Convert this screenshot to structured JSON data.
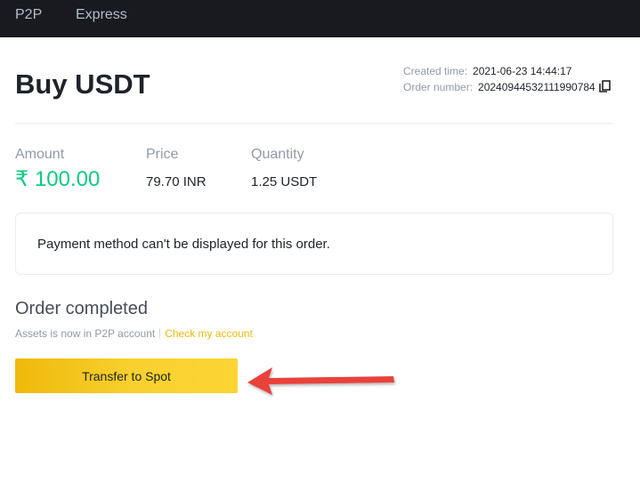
{
  "nav": {
    "items": [
      {
        "label": "P2P"
      },
      {
        "label": "Express"
      }
    ]
  },
  "order": {
    "title": "Buy USDT",
    "created_label": "Created time:",
    "created_value": "2021-06-23 14:44:17",
    "number_label": "Order number:",
    "number_value": "20240944532111990784"
  },
  "stats": {
    "amount_label": "Amount",
    "amount_value": "₹ 100.00",
    "price_label": "Price",
    "price_value": "79.70 INR",
    "quantity_label": "Quantity",
    "quantity_value": "1.25 USDT"
  },
  "payment": {
    "message": "Payment method can't be displayed for this order."
  },
  "status": {
    "title": "Order completed",
    "subtitle": "Assets is now in P2P account",
    "link": "Check my account"
  },
  "actions": {
    "transfer_label": "Transfer to Spot"
  },
  "icons": {
    "copy": "copy-icon",
    "arrow": "red-arrow-annotation-icon"
  },
  "colors": {
    "topbar": "#181a20",
    "amount": "#0ecb81",
    "accent": "#f0b90b",
    "arrow": "#e8423a"
  }
}
